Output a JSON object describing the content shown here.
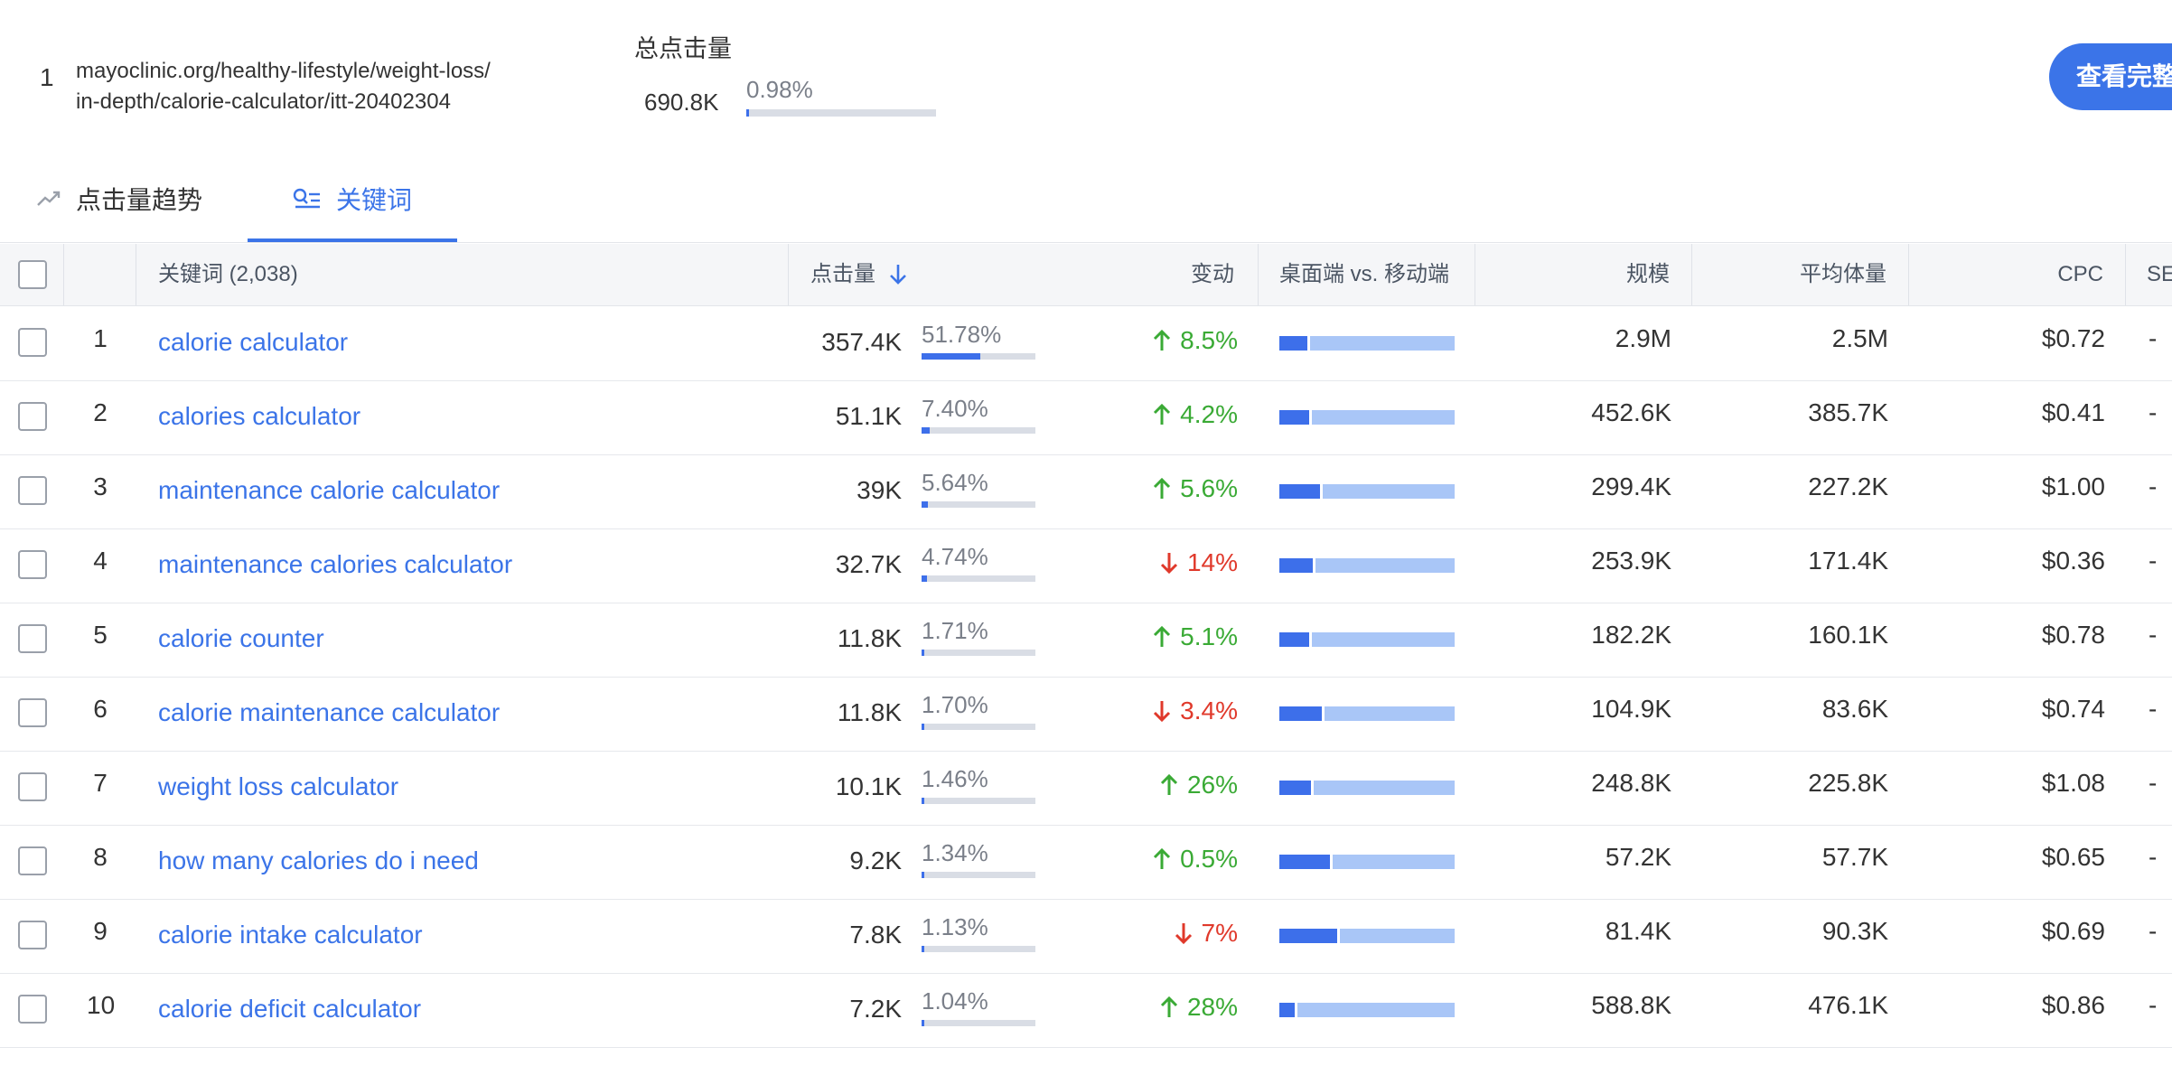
{
  "header": {
    "rank": "1",
    "url_line1": "mayoclinic.org/healthy-lifestyle/weight-loss/",
    "url_line2": "in-depth/calorie-calculator/itt-20402304",
    "total_clicks_label": "总点击量",
    "total_clicks_value": "690.8K",
    "total_clicks_share": "0.98%",
    "total_clicks_share_fraction": 0.0098,
    "full_report_label": "查看完整"
  },
  "tabs": [
    {
      "label": "点击量趋势",
      "icon": "trend-icon",
      "active": false
    },
    {
      "label": "关键词",
      "icon": "keyword-search-icon",
      "active": true
    }
  ],
  "table": {
    "columns": {
      "keyword": "关键词 (2,038)",
      "clicks": "点击量",
      "change": "变动",
      "device": "桌面端 vs. 移动端",
      "volume": "规模",
      "avg_volume": "平均体量",
      "cpc": "CPC",
      "serp": "SE"
    },
    "sort": {
      "column": "clicks",
      "direction": "descending",
      "icon": "arrow-down-icon"
    },
    "rows": [
      {
        "num": "1",
        "keyword": "calorie calculator",
        "clicks": "357.4K",
        "share": "51.78%",
        "share_fraction": 0.5178,
        "change": "8.5%",
        "direction": "up",
        "desktop_share": 0.16,
        "volume": "2.9M",
        "avg_volume": "2.5M",
        "cpc": "$0.72",
        "serp": "-"
      },
      {
        "num": "2",
        "keyword": "calories calculator",
        "clicks": "51.1K",
        "share": "7.40%",
        "share_fraction": 0.074,
        "change": "4.2%",
        "direction": "up",
        "desktop_share": 0.17,
        "volume": "452.6K",
        "avg_volume": "385.7K",
        "cpc": "$0.41",
        "serp": "-"
      },
      {
        "num": "3",
        "keyword": "maintenance calorie calculator",
        "clicks": "39K",
        "share": "5.64%",
        "share_fraction": 0.0564,
        "change": "5.6%",
        "direction": "up",
        "desktop_share": 0.23,
        "volume": "299.4K",
        "avg_volume": "227.2K",
        "cpc": "$1.00",
        "serp": "-"
      },
      {
        "num": "4",
        "keyword": "maintenance calories calculator",
        "clicks": "32.7K",
        "share": "4.74%",
        "share_fraction": 0.0474,
        "change": "14%",
        "direction": "down",
        "desktop_share": 0.19,
        "volume": "253.9K",
        "avg_volume": "171.4K",
        "cpc": "$0.36",
        "serp": "-"
      },
      {
        "num": "5",
        "keyword": "calorie counter",
        "clicks": "11.8K",
        "share": "1.71%",
        "share_fraction": 0.0171,
        "change": "5.1%",
        "direction": "up",
        "desktop_share": 0.17,
        "volume": "182.2K",
        "avg_volume": "160.1K",
        "cpc": "$0.78",
        "serp": "-"
      },
      {
        "num": "6",
        "keyword": "calorie maintenance calculator",
        "clicks": "11.8K",
        "share": "1.70%",
        "share_fraction": 0.017,
        "change": "3.4%",
        "direction": "down",
        "desktop_share": 0.24,
        "volume": "104.9K",
        "avg_volume": "83.6K",
        "cpc": "$0.74",
        "serp": "-"
      },
      {
        "num": "7",
        "keyword": "weight loss calculator",
        "clicks": "10.1K",
        "share": "1.46%",
        "share_fraction": 0.0146,
        "change": "26%",
        "direction": "up",
        "desktop_share": 0.18,
        "volume": "248.8K",
        "avg_volume": "225.8K",
        "cpc": "$1.08",
        "serp": "-"
      },
      {
        "num": "8",
        "keyword": "how many calories do i need",
        "clicks": "9.2K",
        "share": "1.34%",
        "share_fraction": 0.0134,
        "change": "0.5%",
        "direction": "up",
        "desktop_share": 0.29,
        "volume": "57.2K",
        "avg_volume": "57.7K",
        "cpc": "$0.65",
        "serp": "-"
      },
      {
        "num": "9",
        "keyword": "calorie intake calculator",
        "clicks": "7.8K",
        "share": "1.13%",
        "share_fraction": 0.0113,
        "change": "7%",
        "direction": "down",
        "desktop_share": 0.33,
        "volume": "81.4K",
        "avg_volume": "90.3K",
        "cpc": "$0.69",
        "serp": "-"
      },
      {
        "num": "10",
        "keyword": "calorie deficit calculator",
        "clicks": "7.2K",
        "share": "1.04%",
        "share_fraction": 0.0104,
        "change": "28%",
        "direction": "up",
        "desktop_share": 0.09,
        "volume": "588.8K",
        "avg_volume": "476.1K",
        "cpc": "$0.86",
        "serp": "-"
      }
    ]
  },
  "colors": {
    "accent": "#3b74e8",
    "bar_fill": "#3d6fea",
    "mobile_fill": "#a9c6f7",
    "up": "#3aaa35",
    "down": "#e0392b"
  }
}
